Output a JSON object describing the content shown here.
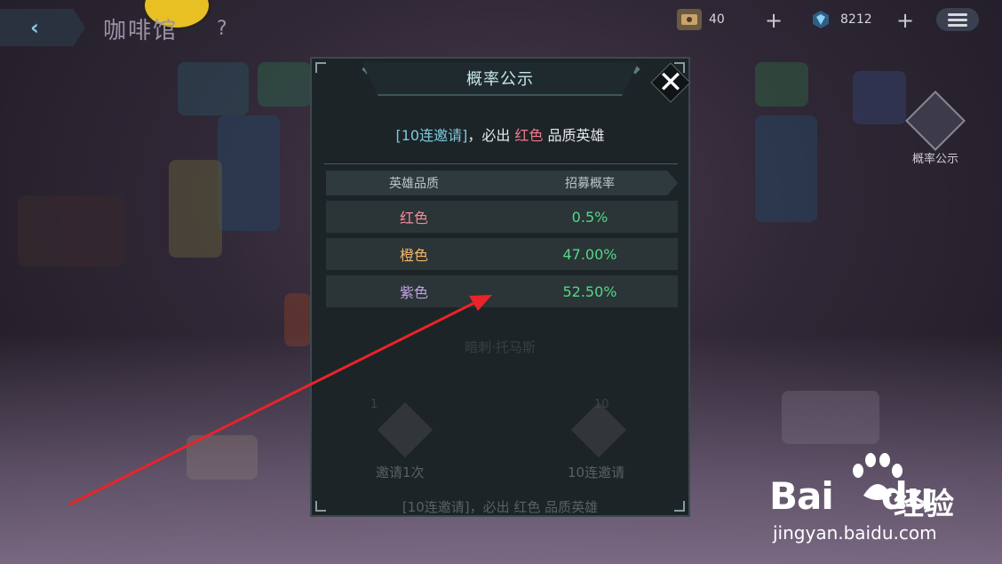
{
  "top_bar": {
    "page_title": "咖啡馆",
    "help": "?",
    "resource_1": {
      "icon": "hero-ticket-icon",
      "value": "40"
    },
    "resource_2": {
      "icon": "crystal-icon",
      "value": "8212"
    },
    "plus": "+"
  },
  "side": {
    "probability_label": "概率公示"
  },
  "dialog": {
    "title": "概率公示",
    "notice": {
      "part1": "[10连邀请]",
      "part2": "，必出 ",
      "part3": "红色",
      "part4": " 品质英雄"
    },
    "table": {
      "headers": [
        "英雄品质",
        "招募概率"
      ],
      "rows": [
        {
          "quality": "红色",
          "rate": "0.5%",
          "color": "#f38a9a"
        },
        {
          "quality": "橙色",
          "rate": "47.00%",
          "color": "#f2b66a"
        },
        {
          "quality": "紫色",
          "rate": "52.50%",
          "color": "#c3a2e6"
        }
      ]
    },
    "background_text": {
      "hint": "暗刺·托马斯",
      "btn1_cost": "1",
      "btn1_label": "邀请1次",
      "btn2_cost": "10",
      "btn2_label": "10连邀请",
      "bottom_notice": "[10连邀请]，必出 红色 品质英雄"
    }
  },
  "watermark": {
    "brand": "Bai",
    "brand2": "du",
    "cn": "经验",
    "url": "jingyan.baidu.com"
  },
  "colors": {
    "rate_green": "#54d88a",
    "arrow_red": "#e8242a"
  }
}
